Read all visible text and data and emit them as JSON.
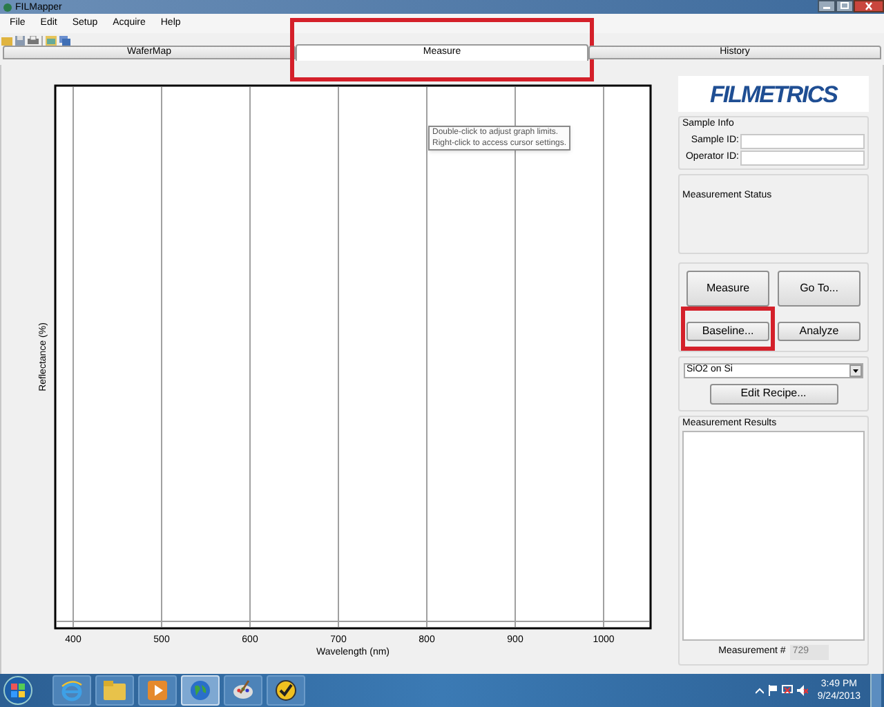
{
  "window": {
    "title": "FILMapper"
  },
  "menu": [
    "File",
    "Edit",
    "Setup",
    "Acquire",
    "Help"
  ],
  "tabs": [
    {
      "label": "WaferMap",
      "selected": false,
      "highlighted": false
    },
    {
      "label": "Measure",
      "selected": true,
      "highlighted": true
    },
    {
      "label": "History",
      "selected": false,
      "highlighted": false
    }
  ],
  "chart": {
    "tooltip": [
      "Double-click to adjust graph limits.",
      "Right-click to access cursor settings."
    ],
    "xlabel": "Wavelength (nm)",
    "ylabel": "Reflectance (%)",
    "x_tick_labels": [
      "400",
      "500",
      "600",
      "700",
      "800",
      "900",
      "1000"
    ]
  },
  "logo": "FILMETRICS",
  "sample_info": {
    "title": "Sample Info",
    "fields": [
      {
        "label": "Sample ID:"
      },
      {
        "label": "Operator ID:"
      }
    ]
  },
  "measurement_status": {
    "title": "Measurement Status"
  },
  "actions": [
    {
      "label": "Measure",
      "highlighted": false
    },
    {
      "label": "Go To...",
      "highlighted": false
    },
    {
      "label": "Baseline...",
      "highlighted": true
    },
    {
      "label": "Analyze",
      "highlighted": false
    }
  ],
  "recipe": {
    "value": "SiO2 on Si",
    "button": "Edit Recipe..."
  },
  "results": {
    "title": "Measurement Results",
    "counter_label": "Measurement #",
    "counter_value": "729"
  },
  "taskbar": {
    "apps": [
      {
        "kind": "ie",
        "selected": false
      },
      {
        "kind": "folder",
        "selected": false
      },
      {
        "kind": "media",
        "selected": false
      },
      {
        "kind": "globe",
        "selected": true
      },
      {
        "kind": "paint",
        "selected": false
      },
      {
        "kind": "check",
        "selected": false
      }
    ],
    "time": "3:49 PM",
    "date": "9/24/2013"
  }
}
